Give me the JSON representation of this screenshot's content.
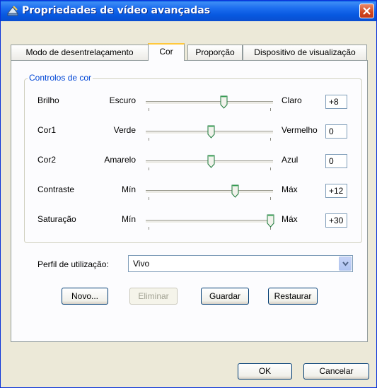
{
  "window": {
    "title": "Propriedades de vídeo avançadas"
  },
  "tabs": [
    {
      "label": "Modo de desentrelaçamento",
      "active": false
    },
    {
      "label": "Cor",
      "active": true
    },
    {
      "label": "Proporção",
      "active": false
    },
    {
      "label": "Dispositivo de visualização",
      "active": false
    }
  ],
  "color_group": {
    "legend": "Controlos de cor"
  },
  "sliders": [
    {
      "label": "Brilho",
      "min_label": "Escuro",
      "max_label": "Claro",
      "value": "+8",
      "position": 0.61
    },
    {
      "label": "Cor1",
      "min_label": "Verde",
      "max_label": "Vermelho",
      "value": "0",
      "position": 0.5
    },
    {
      "label": "Cor2",
      "min_label": "Amarelo",
      "max_label": "Azul",
      "value": "0",
      "position": 0.5
    },
    {
      "label": "Contraste",
      "min_label": "Mín",
      "max_label": "Máx",
      "value": "+12",
      "position": 0.7
    },
    {
      "label": "Saturação",
      "min_label": "Mín",
      "max_label": "Máx",
      "value": "+30",
      "position": 1.0
    }
  ],
  "profile": {
    "label": "Perfil de utilização:",
    "value": "Vivo"
  },
  "buttons": {
    "new": "Novo...",
    "delete": "Eliminar",
    "save": "Guardar",
    "restore": "Restaurar"
  },
  "footer": {
    "ok": "OK",
    "cancel": "Cancelar"
  }
}
